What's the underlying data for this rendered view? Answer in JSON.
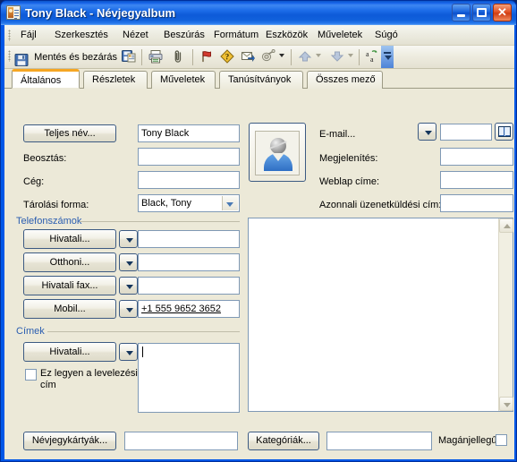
{
  "window": {
    "title": "Tony Black - Névjegyalbum",
    "icon": "contact-card-icon",
    "minimize_label": "Minimize",
    "maximize_label": "Maximize",
    "close_label": "Close",
    "titlebar_color": "#1562e8",
    "client_color": "#ece9d8"
  },
  "menu": {
    "items": [
      {
        "label": "Fájl"
      },
      {
        "label": "Szerkesztés"
      },
      {
        "label": "Nézet"
      },
      {
        "label": "Beszúrás"
      },
      {
        "label": "Formátum"
      },
      {
        "label": "Eszközök"
      },
      {
        "label": "Műveletek"
      },
      {
        "label": "Súgó"
      }
    ]
  },
  "toolbar": {
    "save_close_label": "Mentés és bezárás",
    "icons": [
      "save-icon",
      "save-and-new-icon",
      "print-icon",
      "attach-file-icon",
      "flag-icon",
      "importance-high-icon",
      "forward-icon",
      "previous-item-icon",
      "next-item-icon",
      "spelling-icon",
      "toolbar-options-icon"
    ]
  },
  "tabs": [
    {
      "label": "Általános",
      "active": true
    },
    {
      "label": "Részletek",
      "active": false
    },
    {
      "label": "Műveletek",
      "active": false
    },
    {
      "label": "Tanúsítványok",
      "active": false
    },
    {
      "label": "Összes mező",
      "active": false
    }
  ],
  "general": {
    "full_name_button": "Teljes név...",
    "full_name_value": "Tony Black",
    "job_title_label": "Beosztás:",
    "job_title_value": "",
    "company_label": "Cég:",
    "company_value": "",
    "file_as_label": "Tárolási forma:",
    "file_as_value": "Black, Tony",
    "email_button": "E-mail...",
    "email_value": "",
    "display_as_label": "Megjelenítés:",
    "display_as_value": "",
    "web_page_label": "Weblap címe:",
    "web_page_value": "",
    "im_address_label": "Azonnali üzenetküldési cím:",
    "im_address_value": "",
    "avatar_icon": "contact-photo-icon",
    "address_book_icon": "address-book-icon"
  },
  "phones": {
    "group_label": "Telefonszámok",
    "rows": [
      {
        "button": "Hivatali...",
        "value": ""
      },
      {
        "button": "Otthoni...",
        "value": ""
      },
      {
        "button": "Hivatali fax...",
        "value": ""
      },
      {
        "button": "Mobil...",
        "value": "+1 555 9652 3652"
      }
    ]
  },
  "addresses": {
    "group_label": "Címek",
    "button": "Hivatali...",
    "mailing_checkbox_label": "Ez legyen a levelezési cím",
    "mailing_checked": false,
    "value": ""
  },
  "notes": {
    "value": "",
    "scroll_up_icon": "scroll-up-icon",
    "scroll_down_icon": "scroll-down-icon"
  },
  "footer": {
    "contacts_button": "Névjegykártyák...",
    "contacts_value": "",
    "categories_button": "Kategóriák...",
    "categories_value": "",
    "private_label": "Magánjellegű",
    "private_checked": false
  }
}
